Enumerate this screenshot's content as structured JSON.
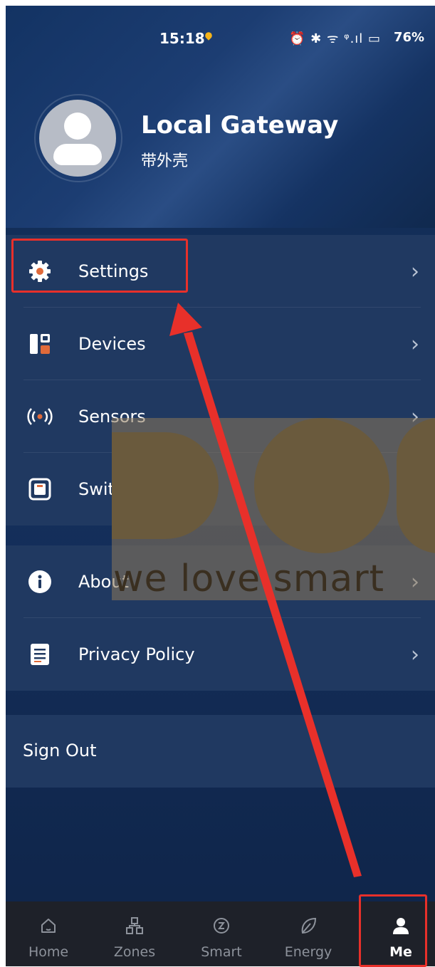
{
  "status_bar": {
    "time": "15:18",
    "icons": "⏰ ✱ ᯤ ᵠ.ıl ▭",
    "battery": "76%"
  },
  "profile": {
    "name": "Local Gateway",
    "subtitle": "带外壳"
  },
  "menu_group_1": [
    {
      "label": "Settings",
      "icon": "gear-icon"
    },
    {
      "label": "Devices",
      "icon": "devices-icon"
    },
    {
      "label": "Sensors",
      "icon": "sensor-icon"
    },
    {
      "label": "Switches",
      "icon": "switch-icon"
    }
  ],
  "menu_group_2": [
    {
      "label": "About",
      "icon": "info-icon"
    },
    {
      "label": "Privacy Policy",
      "icon": "document-icon"
    }
  ],
  "chevron": "›",
  "sign_out": "Sign Out",
  "watermark": "we love smart",
  "tabbar": [
    {
      "label": "Home",
      "icon": "home-icon"
    },
    {
      "label": "Zones",
      "icon": "zones-icon"
    },
    {
      "label": "Smart",
      "icon": "smart-icon"
    },
    {
      "label": "Energy",
      "icon": "leaf-icon"
    },
    {
      "label": "Me",
      "icon": "person-icon"
    }
  ],
  "colors": {
    "accent_red": "#e8302a",
    "menu_bg": "#203961",
    "tabbar_bg": "#1e2129",
    "icon_orange": "#e06a3a"
  }
}
